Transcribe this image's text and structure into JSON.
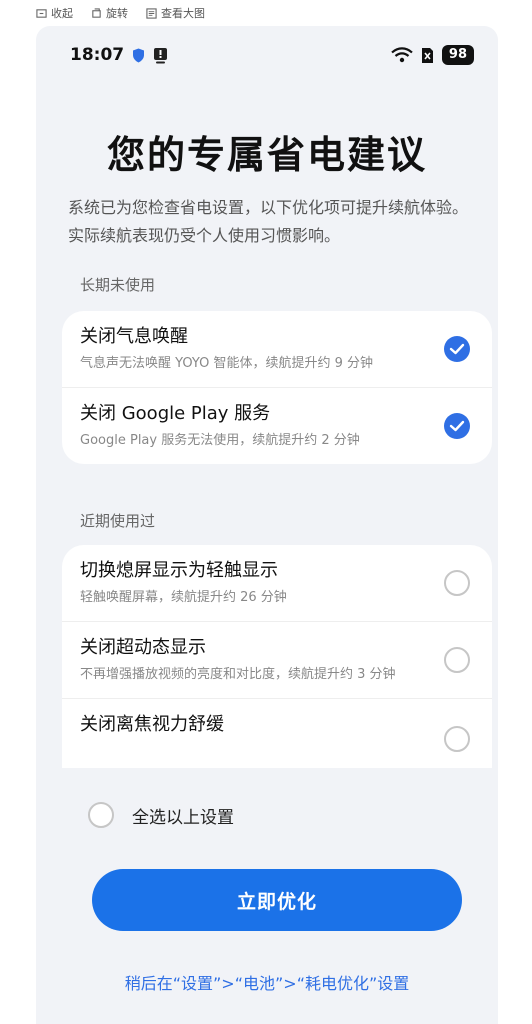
{
  "viewer_toolbar": {
    "collapse": "收起",
    "rotate": "旋转",
    "view_large": "查看大图"
  },
  "status_bar": {
    "time": "18:07",
    "battery": "98"
  },
  "page": {
    "title": "您的专属省电建议",
    "description": "系统已为您检查省电设置，以下优化项可提升续航体验。实际续航表现仍受个人使用习惯影响。"
  },
  "sections": [
    {
      "label": "长期未使用",
      "items": [
        {
          "title": "关闭气息唤醒",
          "subtitle": "气息声无法唤醒 YOYO 智能体，续航提升约 9 分钟",
          "checked": true
        },
        {
          "title": "关闭 Google Play 服务",
          "subtitle": "Google Play 服务无法使用，续航提升约 2 分钟",
          "checked": true
        }
      ]
    },
    {
      "label": "近期使用过",
      "items": [
        {
          "title": "切换熄屏显示为轻触显示",
          "subtitle": "轻触唤醒屏幕，续航提升约 26 分钟",
          "checked": false
        },
        {
          "title": "关闭超动态显示",
          "subtitle": "不再增强播放视频的亮度和对比度，续航提升约 3 分钟",
          "checked": false
        },
        {
          "title": "关闭离焦视力舒缓",
          "subtitle": "",
          "checked": false
        }
      ]
    }
  ],
  "select_all_label": "全选以上设置",
  "optimize_button": "立即优化",
  "footer_link": "稍后在“设置”>“电池”>“耗电优化”设置",
  "colors": {
    "accent": "#1b72e8",
    "check": "#2f6fe4",
    "background": "#f1f3f7"
  }
}
